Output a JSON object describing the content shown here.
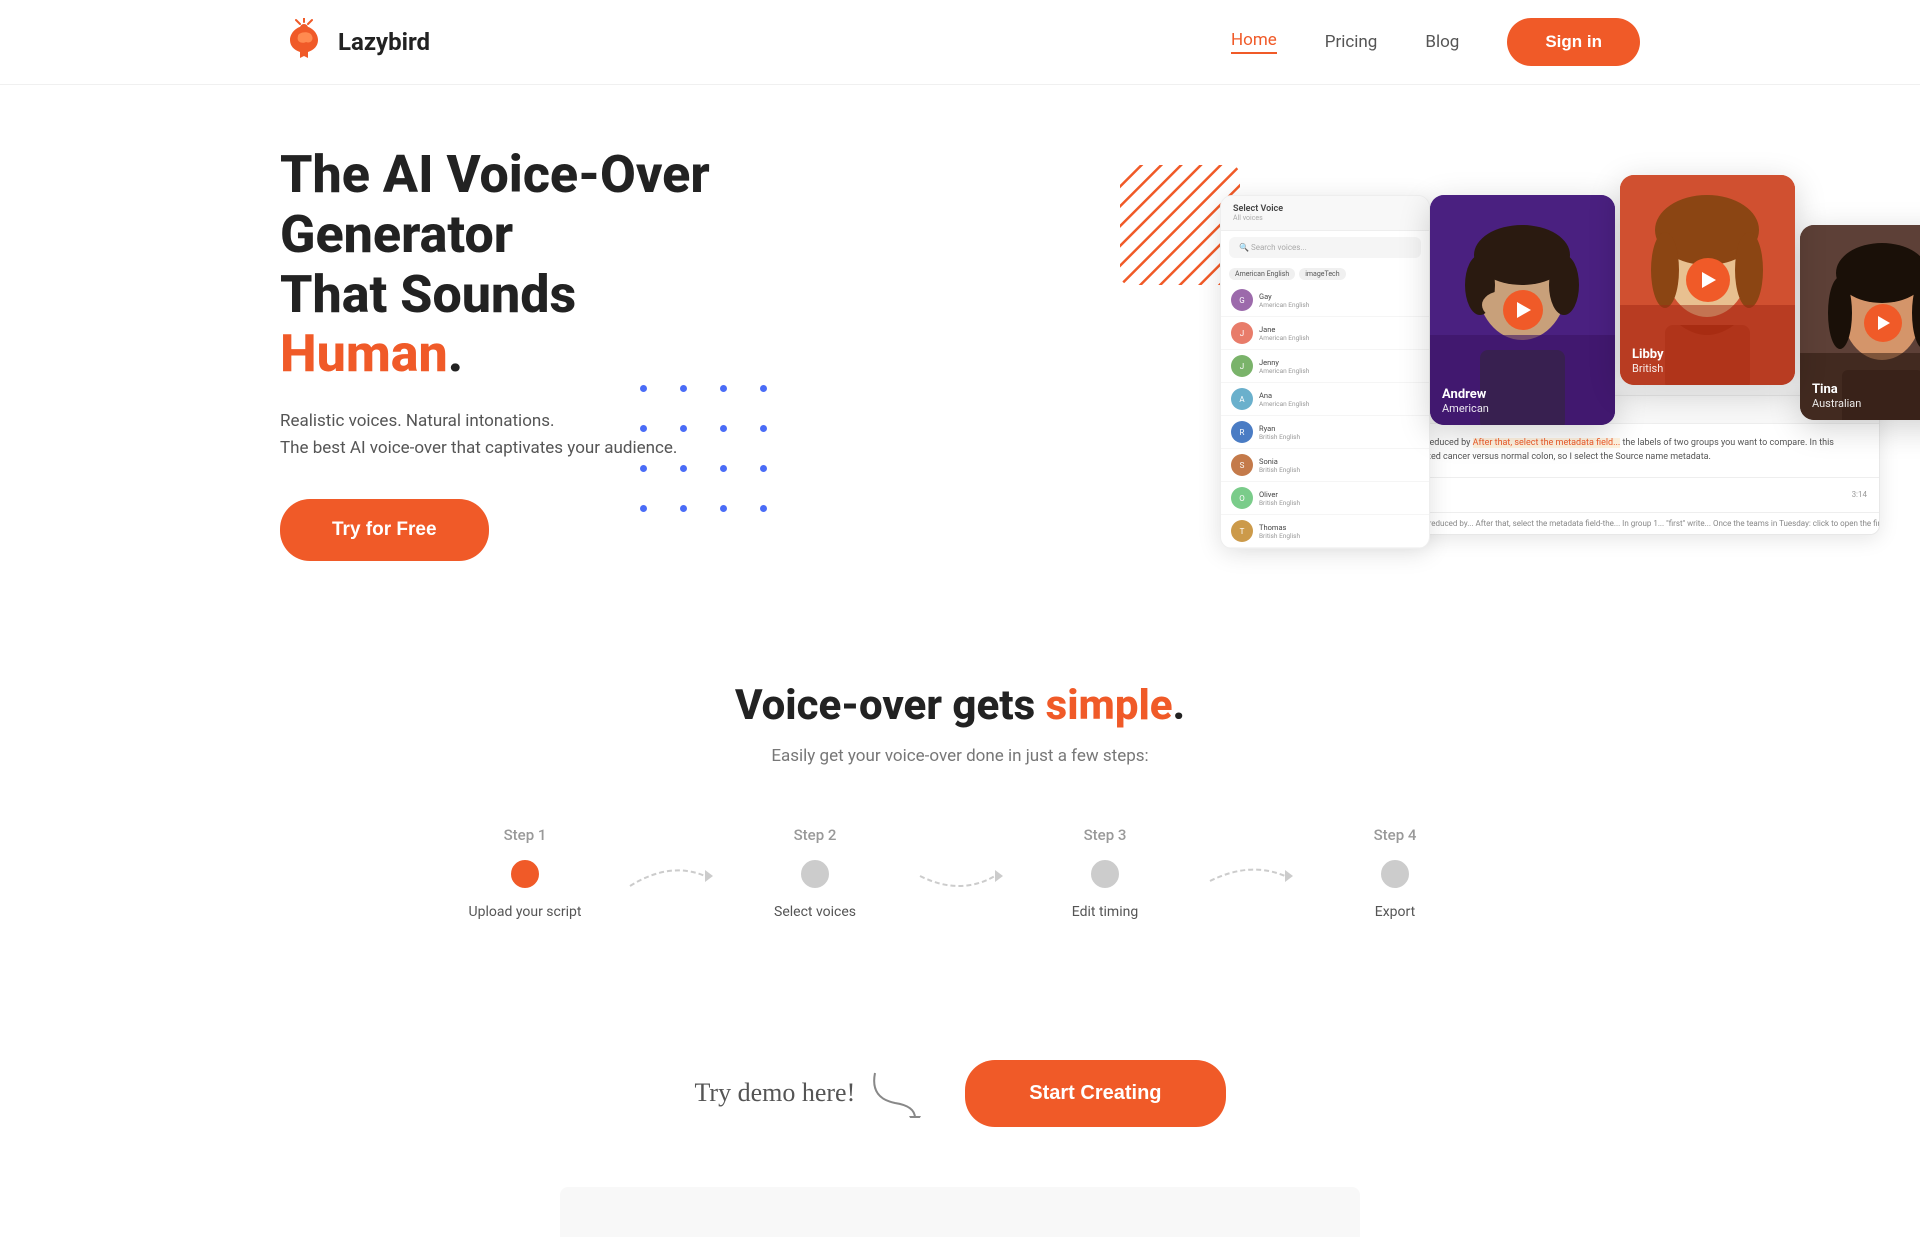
{
  "logo": {
    "text": "Lazybird"
  },
  "nav": {
    "home": "Home",
    "pricing": "Pricing",
    "blog": "Blog",
    "signin": "Sign in"
  },
  "hero": {
    "title_part1": "The AI Voice-Over Generator",
    "title_part2": "That Sounds ",
    "title_highlight": "Human",
    "title_end": ".",
    "subtitle_line1": "Realistic voices. Natural intonations.",
    "subtitle_line2": "The best AI voice-over that captivates your audience.",
    "cta_button": "Try for Free"
  },
  "voices": [
    {
      "name": "Andrew",
      "lang": "American",
      "bg": "#6a4c9c"
    },
    {
      "name": "Libby",
      "lang": "British",
      "bg": "#c8522a"
    },
    {
      "name": "Tina",
      "lang": "Australian",
      "bg": "#5d4037"
    }
  ],
  "simple_section": {
    "title_part1": "Voice-over gets ",
    "title_highlight": "simple",
    "title_end": ".",
    "subtitle": "Easily get your voice-over done in just a few steps:"
  },
  "steps": [
    {
      "label": "Step 1",
      "desc": "Upload your script",
      "active": true
    },
    {
      "label": "Step 2",
      "desc": "Select voices",
      "active": false
    },
    {
      "label": "Step 3",
      "desc": "Edit timing",
      "active": false
    },
    {
      "label": "Step 4",
      "desc": "Export",
      "active": false
    }
  ],
  "demo": {
    "label": "Try demo here!",
    "cta": "Start Creating"
  },
  "mockup_voices": [
    {
      "name": "Gay",
      "lang": "American English"
    },
    {
      "name": "Jane",
      "lang": "American English"
    },
    {
      "name": "Jenny",
      "lang": "American English"
    },
    {
      "name": "Ana",
      "lang": "American English"
    },
    {
      "name": "Ryan",
      "lang": "British English"
    },
    {
      "name": "Sonia",
      "lang": "British English"
    },
    {
      "name": "Oliver",
      "lang": "British English"
    },
    {
      "name": "Thomas",
      "lang": "British English"
    }
  ]
}
